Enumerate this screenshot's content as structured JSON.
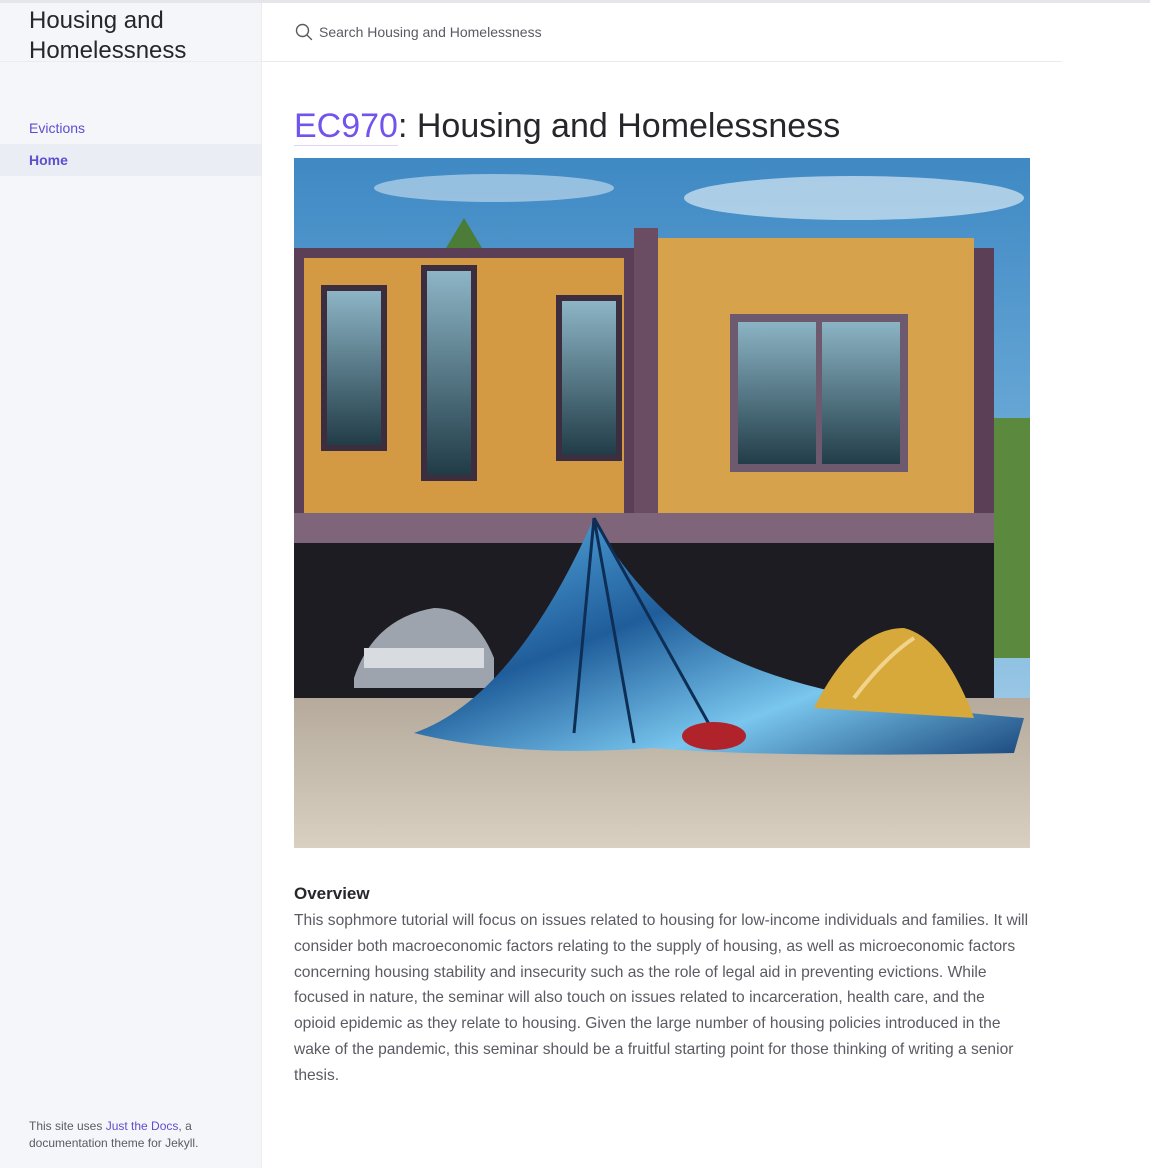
{
  "site": {
    "title": "Housing and Homelessness"
  },
  "search": {
    "placeholder": "Search Housing and Homelessness"
  },
  "nav": {
    "items": [
      {
        "label": "Evictions",
        "active": false
      },
      {
        "label": "Home",
        "active": true
      }
    ]
  },
  "footer": {
    "prefix": "This site uses ",
    "link": "Just the Docs",
    "suffix": ", a documentation theme for Jekyll."
  },
  "page": {
    "title_link": "EC970",
    "title_rest": ": Housing and Homelessness",
    "overview_heading": "Overview",
    "overview_text": "This sophmore tutorial will focus on issues related to housing for low-income individuals and families. It will consider both macroeconomic factors relating to the supply of housing, as well as microeconomic factors concerning housing stability and insecurity such as the role of legal aid in preventing evictions. While focused in nature, the seminar will also touch on issues related to incarceration, health care, and the opioid epidemic as they relate to housing. Given the large number of housing policies introduced in the wake of the pandemic, this seminar should be a fruitful starting point for those thinking of writing a senior thesis."
  },
  "colors": {
    "link": "#7253ed",
    "nav_link": "#5c4fcf",
    "sidebar_bg": "#f5f6fa",
    "text": "#27262b",
    "body_text": "#5c5962"
  },
  "icons": {
    "search": "search-icon"
  }
}
